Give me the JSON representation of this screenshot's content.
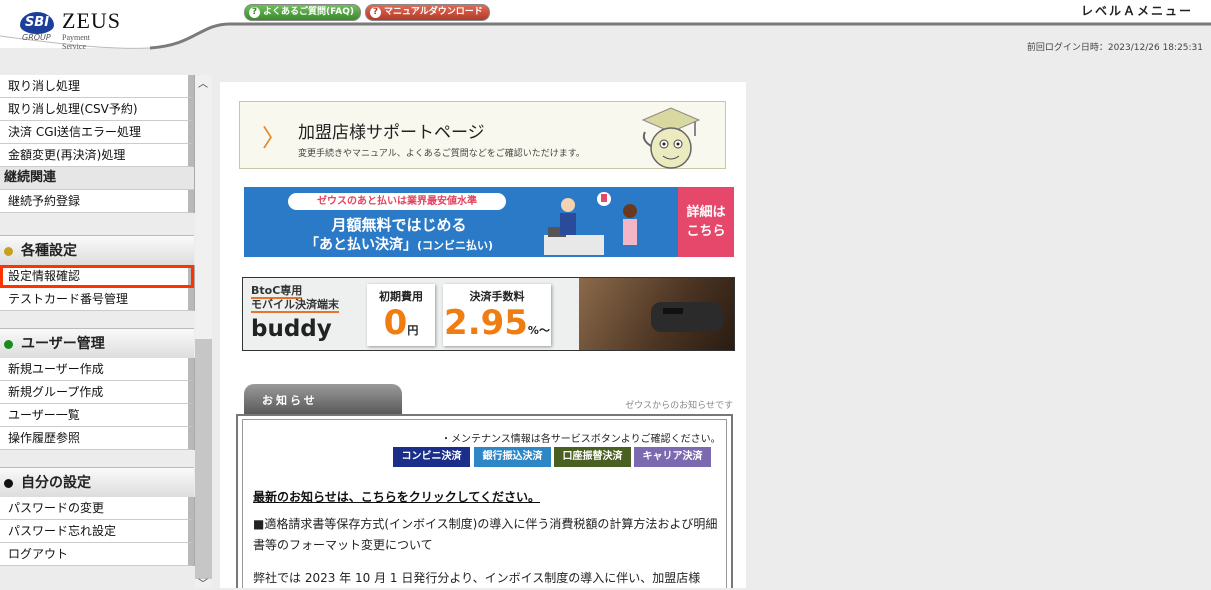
{
  "header": {
    "logo_sbi": "SBI",
    "logo_zeus": "ZEUS",
    "logo_group": "GROUP",
    "logo_ps": "Payment Service",
    "faq_label": "よくあるご質問(FAQ)",
    "manual_label": "マニュアルダウンロード",
    "level_menu": "レベルＡメニュー",
    "last_login": "前回ログイン日時：2023/12/26 18:25:31"
  },
  "sidebar": {
    "items_top": [
      "取り消し処理",
      "取り消し処理(CSV予約)",
      "決済 CGI送信エラー処理",
      "金額変更(再決済)処理"
    ],
    "cat_keizoku": "継続関連",
    "item_keizoku": "継続予約登録",
    "sections": {
      "settings": {
        "title": "各種設定",
        "color": "#c8a020",
        "items": [
          "設定情報確認",
          "テストカード番号管理"
        ]
      },
      "users": {
        "title": "ユーザー管理",
        "color": "#1d8a1d",
        "items": [
          "新規ユーザー作成",
          "新規グループ作成",
          "ユーザー一覧",
          "操作履歴参照"
        ]
      },
      "mine": {
        "title": "自分の設定",
        "color": "#111111",
        "items": [
          "パスワードの変更",
          "パスワード忘れ設定",
          "ログアウト"
        ]
      }
    }
  },
  "main": {
    "support": {
      "title": "加盟店様サポートページ",
      "sub": "変更手続きやマニュアル、よくあるご質問などをご確認いただけます。"
    },
    "banner1": {
      "pill": "ゼウスのあと払いは業界最安値水準",
      "line2": "月額無料ではじめる",
      "line3": "「あと払い決済」",
      "line3_small": "(コンビニ払い)",
      "detail_1": "詳細は",
      "detail_2": "こちら"
    },
    "banner2": {
      "tag1": "BtoC専用",
      "tag2": "モバイル決済端末",
      "name": "buddy",
      "fee_label": "初期費用",
      "fee_value": "0",
      "fee_unit": "円",
      "rate_label": "決済手数料",
      "rate_value": "2.95",
      "rate_unit": "%～"
    },
    "news": {
      "tab": "お知らせ",
      "from": "ゼウスからのお知らせです",
      "maintenance": "・メンテナンス情報は各サービスボタンよりご確認ください。",
      "buttons": [
        {
          "label": "コンビニ決済",
          "color": "#1b2f8a"
        },
        {
          "label": "銀行振込決済",
          "color": "#2f86c6"
        },
        {
          "label": "口座振替決済",
          "color": "#4a5f22"
        },
        {
          "label": "キャリア決済",
          "color": "#7b6ab0"
        }
      ],
      "latest": "最新のお知らせは、こちらをクリックしてください。",
      "para1": "■適格請求書等保存方式(インボイス制度)の導入に伴う消費税額の計算方法および明細書等のフォーマット変更について",
      "para2": "弊社では 2023 年 10 月 1 日発行分より、インボイス制度の導入に伴い、加盟店様"
    }
  }
}
